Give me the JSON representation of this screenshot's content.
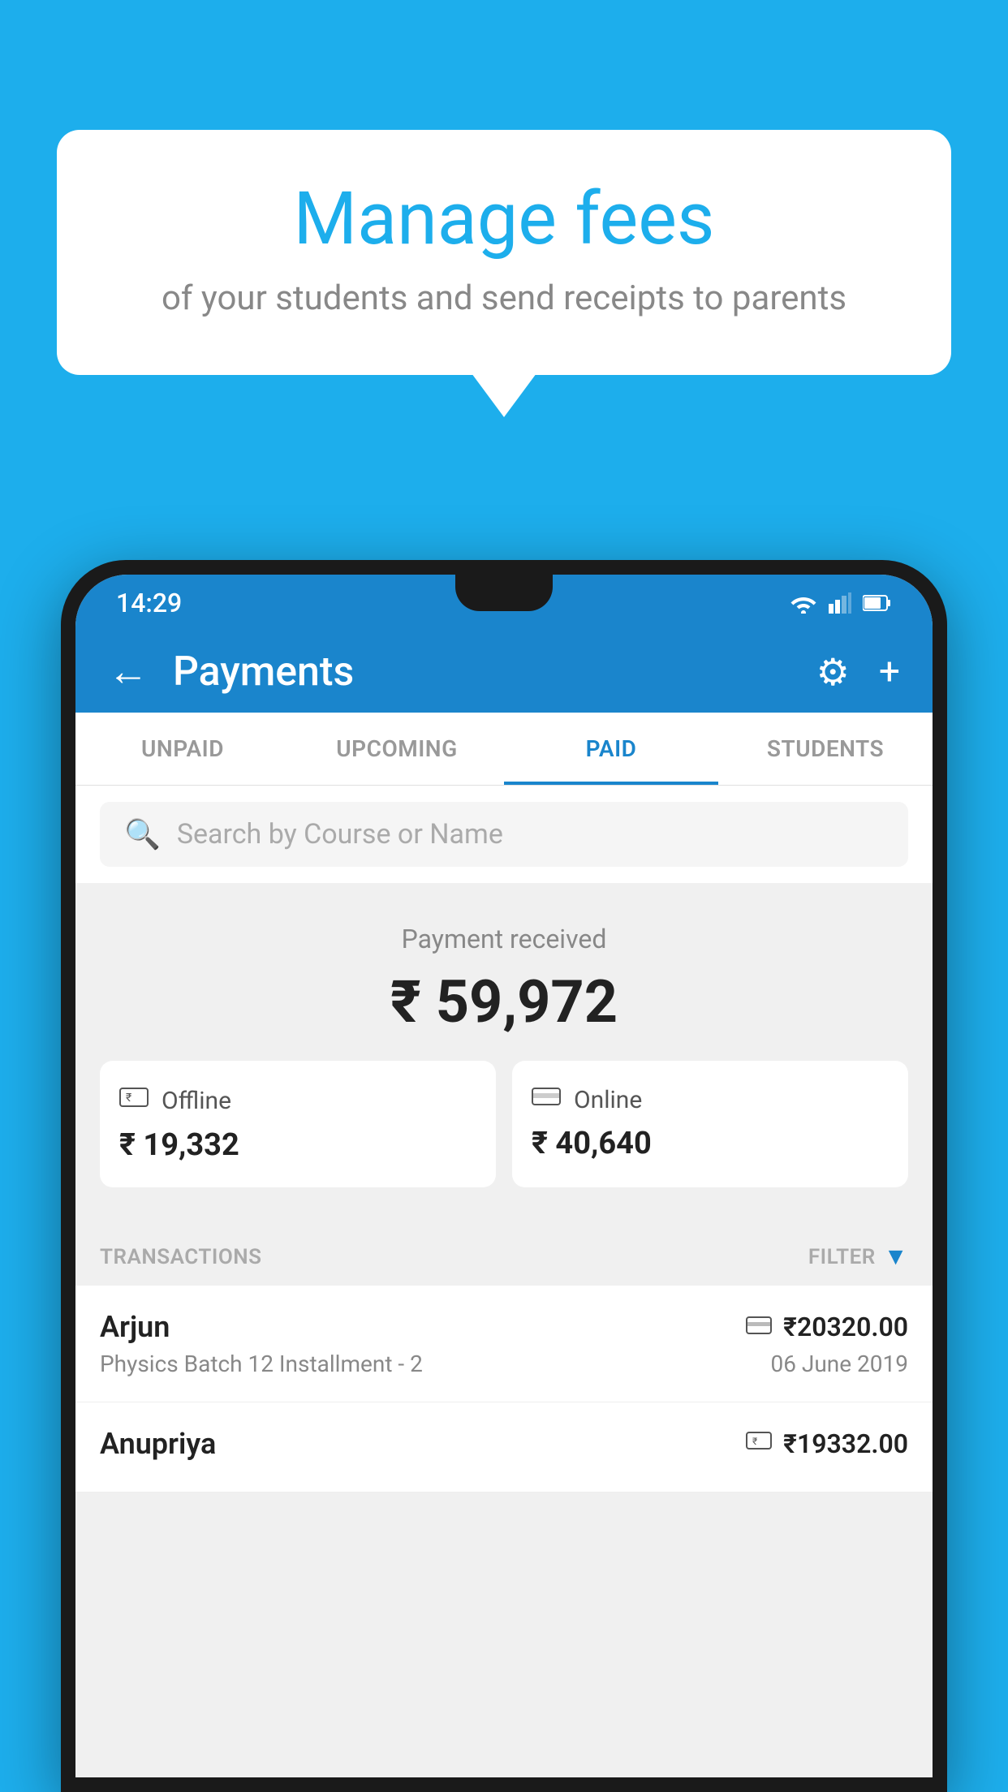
{
  "background_color": "#1DAEEC",
  "speech_bubble": {
    "title": "Manage fees",
    "subtitle": "of your students and send receipts to parents"
  },
  "status_bar": {
    "time": "14:29"
  },
  "app_header": {
    "title": "Payments",
    "back_label": "←",
    "settings_label": "⚙",
    "add_label": "+"
  },
  "tabs": [
    {
      "id": "unpaid",
      "label": "UNPAID",
      "active": false
    },
    {
      "id": "upcoming",
      "label": "UPCOMING",
      "active": false
    },
    {
      "id": "paid",
      "label": "PAID",
      "active": true
    },
    {
      "id": "students",
      "label": "STUDENTS",
      "active": false
    }
  ],
  "search": {
    "placeholder": "Search by Course or Name"
  },
  "payment_summary": {
    "label": "Payment received",
    "total": "₹ 59,972",
    "offline_label": "Offline",
    "offline_amount": "₹ 19,332",
    "online_label": "Online",
    "online_amount": "₹ 40,640"
  },
  "transactions_section": {
    "header_label": "TRANSACTIONS",
    "filter_label": "FILTER"
  },
  "transactions": [
    {
      "name": "Arjun",
      "course": "Physics Batch 12 Installment - 2",
      "amount": "₹20320.00",
      "date": "06 June 2019",
      "payment_type": "online"
    },
    {
      "name": "Anupriya",
      "course": "",
      "amount": "₹19332.00",
      "date": "",
      "payment_type": "offline"
    }
  ]
}
